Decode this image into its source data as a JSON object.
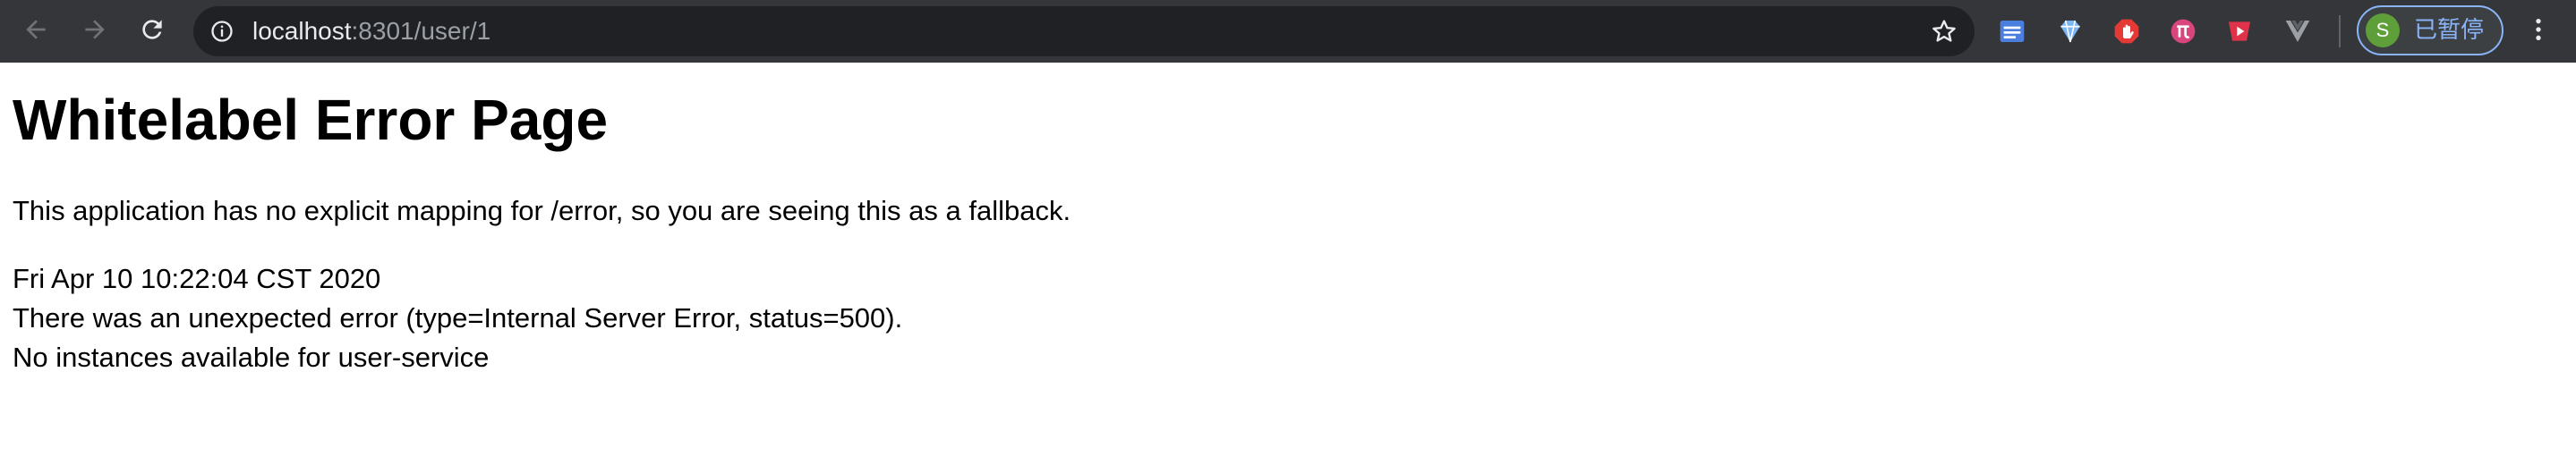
{
  "browser": {
    "url_host": "localhost",
    "url_rest": ":8301/user/1",
    "profile_initial": "S",
    "profile_label": "已暂停"
  },
  "page": {
    "title": "Whitelabel Error Page",
    "message": "This application has no explicit mapping for /error, so you are seeing this as a fallback.",
    "timestamp": "Fri Apr 10 10:22:04 CST 2020",
    "error_line": "There was an unexpected error (type=Internal Server Error, status=500).",
    "detail": "No instances available for user-service"
  },
  "colors": {
    "toolbar_bg": "#35363a",
    "omnibox_bg": "#202124",
    "accent": "#8ab4f8"
  },
  "icons": [
    "back-arrow-icon",
    "forward-arrow-icon",
    "reload-icon",
    "info-icon",
    "star-icon",
    "extension-icons",
    "kebab-menu-icon"
  ]
}
